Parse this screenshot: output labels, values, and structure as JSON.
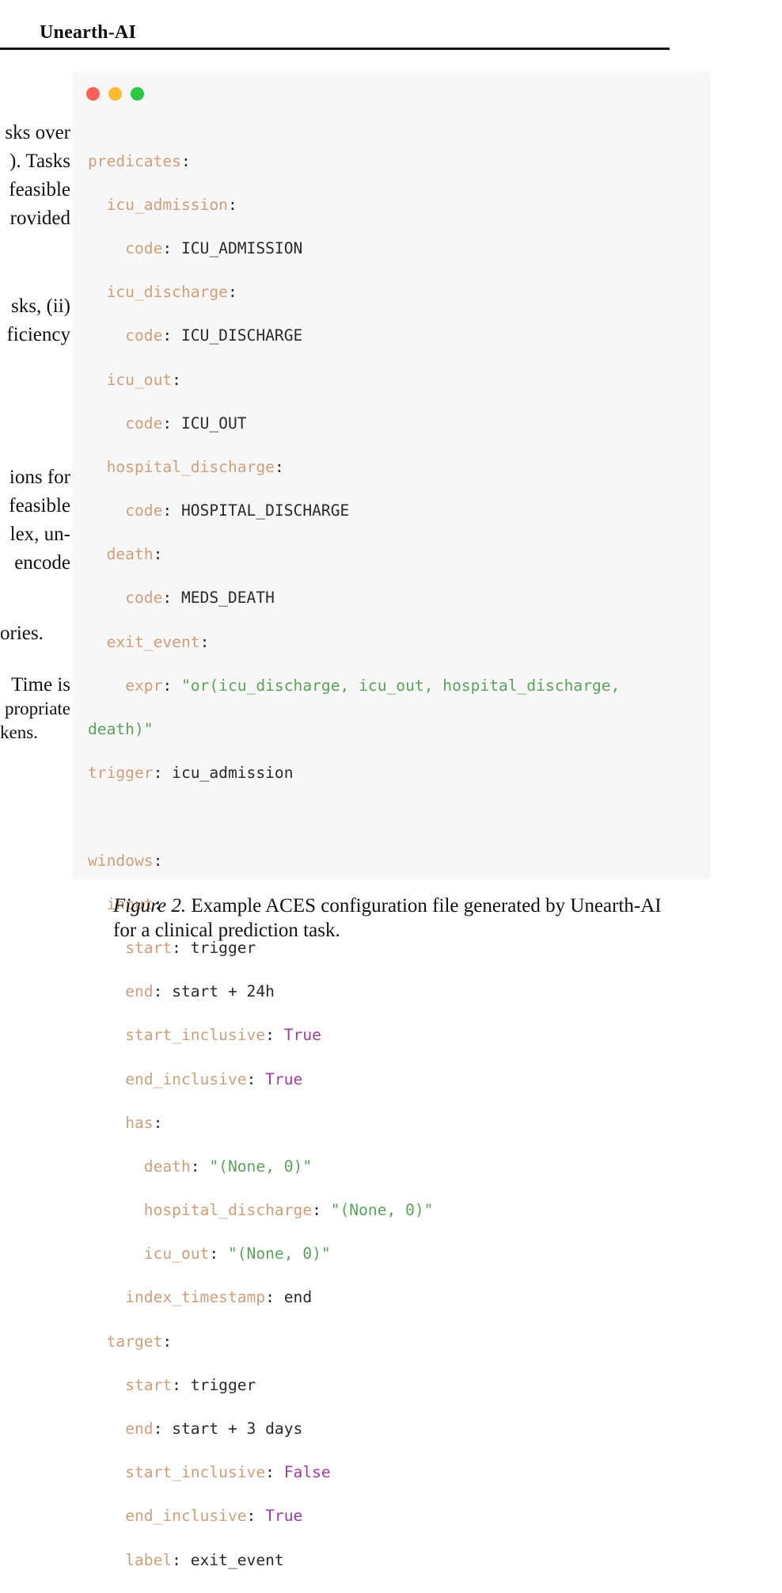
{
  "header": {
    "title": "Unearth-AI"
  },
  "left_column_fragments": [
    "sks over",
    "). Tasks",
    "feasible",
    "rovided",
    "sks, (ii)",
    "ficiency",
    "ions for",
    "feasible",
    "lex, un-",
    "encode",
    "ories.",
    "Time is",
    "propriate",
    "kens."
  ],
  "window_controls": {
    "colors": [
      "#ff5f57",
      "#febc2e",
      "#28c840"
    ]
  },
  "code": {
    "predicates_key": "predicates",
    "icu_admission_key": "icu_admission",
    "icu_admission_code_key": "code",
    "icu_admission_code": "ICU_ADMISSION",
    "icu_discharge_key": "icu_discharge",
    "icu_discharge_code_key": "code",
    "icu_discharge_code": "ICU_DISCHARGE",
    "icu_out_key": "icu_out",
    "icu_out_code_key": "code",
    "icu_out_code": "ICU_OUT",
    "hospital_discharge_key": "hospital_discharge",
    "hospital_discharge_code_key": "code",
    "hospital_discharge_code": "HOSPITAL_DISCHARGE",
    "death_key": "death",
    "death_code_key": "code",
    "death_code": "MEDS_DEATH",
    "exit_event_key": "exit_event",
    "expr_key": "expr",
    "expr_value_1": "\"or(icu_discharge, icu_out, hospital_discharge,",
    "expr_value_2": "death)\"",
    "trigger_key": "trigger",
    "trigger_value": "icu_admission",
    "windows_key": "windows",
    "input_key": "input",
    "input_start_key": "start",
    "input_start": "trigger",
    "input_end_key": "end",
    "input_end": "start + 24h",
    "input_start_inclusive_key": "start_inclusive",
    "input_start_inclusive": "True",
    "input_end_inclusive_key": "end_inclusive",
    "input_end_inclusive": "True",
    "has_key": "has",
    "has_death_key": "death",
    "has_death": "\"(None, 0)\"",
    "has_hospital_discharge_key": "hospital_discharge",
    "has_hospital_discharge": "\"(None, 0)\"",
    "has_icu_out_key": "icu_out",
    "has_icu_out": "\"(None, 0)\"",
    "index_timestamp_key": "index_timestamp",
    "index_timestamp": "end",
    "target_key": "target",
    "target_start_key": "start",
    "target_start": "trigger",
    "target_end_key": "end",
    "target_end": "start + 3 days",
    "target_start_inclusive_key": "start_inclusive",
    "target_start_inclusive": "False",
    "target_end_inclusive_key": "end_inclusive",
    "target_end_inclusive": "True",
    "label_key": "label",
    "label_value": "exit_event"
  },
  "caption": {
    "figure_label": "Figure 2.",
    "text": "Example ACES configuration file generated by Unearth-AI for a clinical prediction task."
  }
}
